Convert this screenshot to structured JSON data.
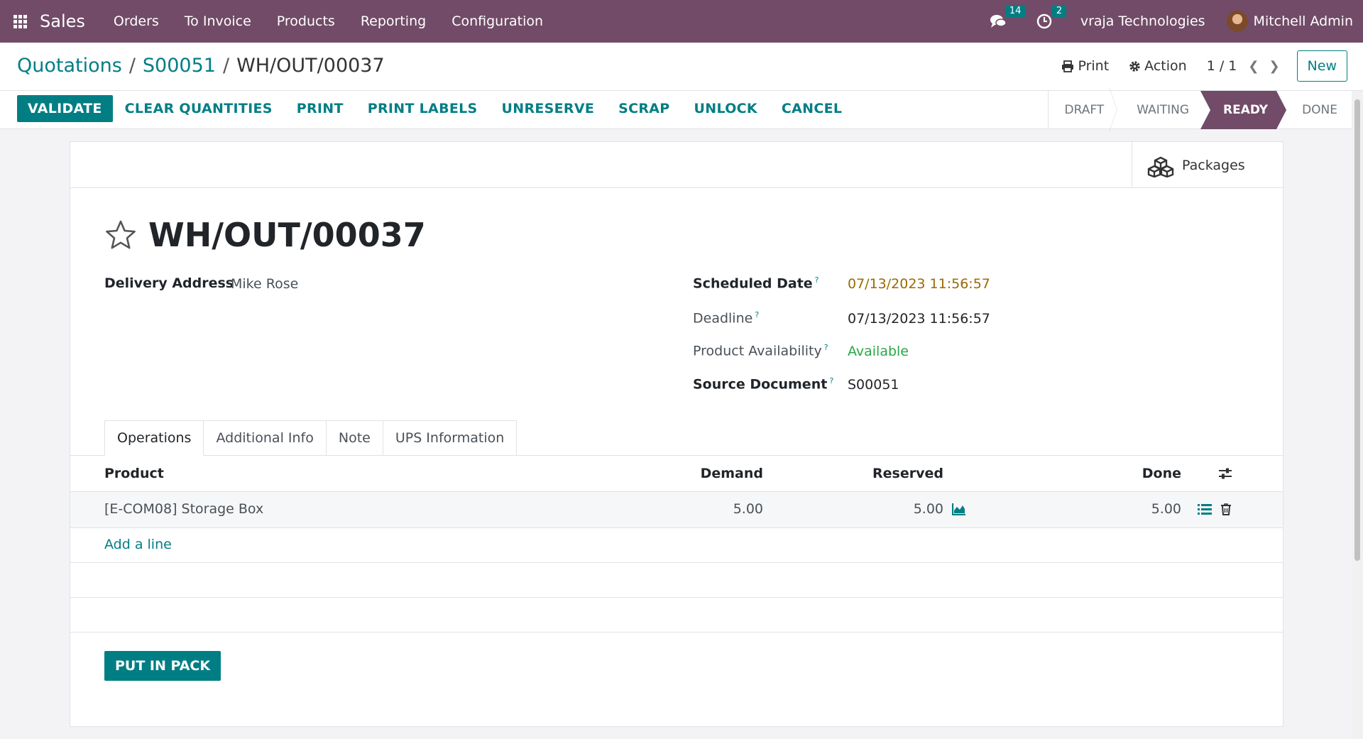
{
  "navbar": {
    "app_name": "Sales",
    "menu": [
      "Orders",
      "To Invoice",
      "Products",
      "Reporting",
      "Configuration"
    ],
    "messages_count": "14",
    "activities_count": "2",
    "company": "vraja Technologies",
    "user": "Mitchell Admin"
  },
  "breadcrumb": {
    "items": [
      "Quotations",
      "S00051"
    ],
    "current": "WH/OUT/00037"
  },
  "control": {
    "print_label": "Print",
    "action_label": "Action",
    "pager": "1 / 1",
    "new_label": "New"
  },
  "statusbar": {
    "buttons": {
      "validate": "VALIDATE",
      "clear_quantities": "CLEAR QUANTITIES",
      "print": "PRINT",
      "print_labels": "PRINT LABELS",
      "unreserve": "UNRESERVE",
      "scrap": "SCRAP",
      "unlock": "UNLOCK",
      "cancel": "CANCEL"
    },
    "stages": [
      "DRAFT",
      "WAITING",
      "READY",
      "DONE"
    ],
    "active_stage": "READY"
  },
  "colors": {
    "brand": "#714b67",
    "accent": "#017e84",
    "warning": "#9a6a00",
    "success": "#28a745"
  },
  "form": {
    "packages_label": "Packages",
    "title": "WH/OUT/00037",
    "delivery_address_label": "Delivery Address",
    "delivery_address": "Mike Rose",
    "scheduled_date_label": "Scheduled Date",
    "scheduled_date": "07/13/2023 11:56:57",
    "deadline_label": "Deadline",
    "deadline": "07/13/2023 11:56:57",
    "availability_label": "Product Availability",
    "availability": "Available",
    "source_document_label": "Source Document",
    "source_document": "S00051",
    "help_mark": "?"
  },
  "tabs": [
    "Operations",
    "Additional Info",
    "Note",
    "UPS Information"
  ],
  "operations": {
    "columns": {
      "product": "Product",
      "demand": "Demand",
      "reserved": "Reserved",
      "done": "Done"
    },
    "rows": [
      {
        "product": "[E-COM08] Storage Box",
        "demand": "5.00",
        "reserved": "5.00",
        "done": "5.00"
      }
    ],
    "add_line": "Add a line"
  },
  "footer": {
    "put_in_pack": "PUT IN PACK"
  }
}
